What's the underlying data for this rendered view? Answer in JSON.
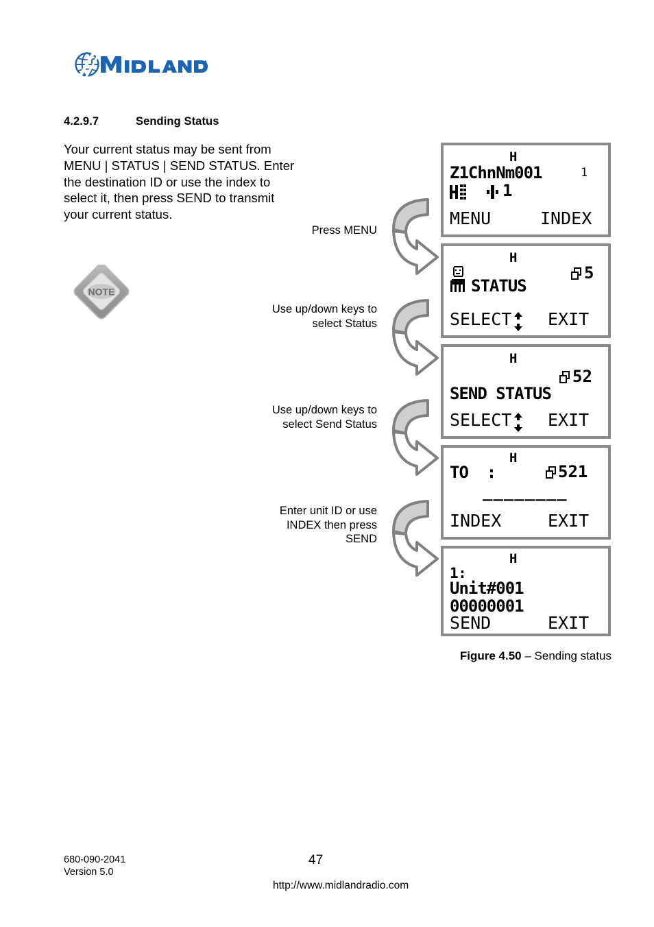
{
  "logo": {
    "brand": "MIDLAND",
    "globe_icon": "globe-icon",
    "color": "#1C63B0"
  },
  "heading": {
    "number": "4.2.9.7",
    "title": "Sending Status"
  },
  "body": {
    "paragraph": "Your current status may be sent from MENU | STATUS | SEND STATUS. Enter the destination ID or use the index to select it, then press SEND to transmit your current status."
  },
  "note": {
    "label": "NOTE",
    "icon": "note-diamond-icon"
  },
  "steps": [
    {
      "label": "Press MENU"
    },
    {
      "label": "Use up/down keys to select Status"
    },
    {
      "label": "Use up/down keys to select Send Status"
    },
    {
      "label": "Enter unit ID or use INDEX then press SEND"
    }
  ],
  "screens": [
    {
      "id": "screen-home",
      "title": "H",
      "line1": "Z1ChnNm001",
      "line1_right": "1",
      "line2_icon": "channel-signal-icon",
      "line2": "1",
      "softkey_left": "MENU",
      "softkey_right": "INDEX"
    },
    {
      "id": "screen-status-menu",
      "title": "H",
      "icon": "person-icon",
      "label": "STATUS",
      "counter_icon": "pages-icon",
      "counter": "5",
      "softkey_left": "SELECT",
      "softkey_left_icon": "up-down-arrows-icon",
      "softkey_right": "EXIT"
    },
    {
      "id": "screen-send-status",
      "title": "H",
      "label": "SEND STATUS",
      "counter_icon": "pages-icon",
      "counter": "52",
      "softkey_left": "SELECT",
      "softkey_left_icon": "up-down-arrows-icon",
      "softkey_right": "EXIT"
    },
    {
      "id": "screen-to-entry",
      "title": "H",
      "label": "TO  :",
      "counter_icon": "pages-icon",
      "counter": "521",
      "entry_field": "________",
      "softkey_left": "INDEX",
      "softkey_right": "EXIT"
    },
    {
      "id": "screen-index-unit",
      "title": "H",
      "line1": "1:",
      "line2": "Unit#001",
      "line3": "00000001",
      "softkey_left": "SEND",
      "softkey_right": "EXIT"
    }
  ],
  "caption": {
    "figure": "Figure 4.50",
    "dash": " – ",
    "text": "Sending status"
  },
  "footer": {
    "doc_number": "680-090-2041",
    "version": "Version 5.0",
    "page_number": "47",
    "url": "http://www.midlandradio.com"
  }
}
